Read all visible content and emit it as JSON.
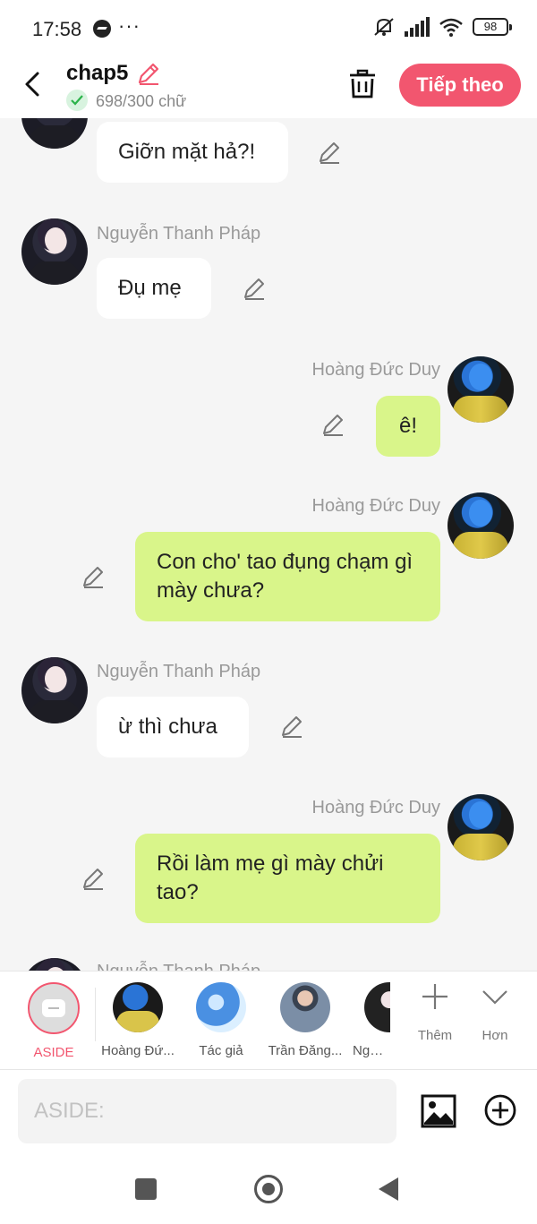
{
  "status_bar": {
    "time": "17:58",
    "dots": "···",
    "battery": "98"
  },
  "header": {
    "title": "chap5",
    "word_count": "698/300 chữ",
    "next_label": "Tiếp theo"
  },
  "messages": [
    {
      "side": "left",
      "sender": "",
      "text": "Giỡn mặt hả?!"
    },
    {
      "side": "left",
      "sender": "Nguyễn Thanh Pháp",
      "text": "Đụ mẹ"
    },
    {
      "side": "right",
      "sender": "Hoàng Đức Duy",
      "text": "ê!"
    },
    {
      "side": "right",
      "sender": "Hoàng Đức Duy",
      "text": "Con cho' tao đụng chạm gì mày chưa?"
    },
    {
      "side": "left",
      "sender": "Nguyễn Thanh Pháp",
      "text": "ừ thì chưa"
    },
    {
      "side": "right",
      "sender": "Hoàng Đức Duy",
      "text": "Rồi làm mẹ gì mày chửi tao?"
    },
    {
      "side": "left",
      "sender": "Nguyễn Thanh Pháp",
      "text": ""
    }
  ],
  "characters": [
    {
      "name": "ASIDE"
    },
    {
      "name": "Hoàng Đứ..."
    },
    {
      "name": "Tác giả"
    },
    {
      "name": "Trần Đăng..."
    },
    {
      "name": "Nguyễ"
    }
  ],
  "tools": {
    "more_label": "Thêm",
    "expand_label": "Hơn"
  },
  "input": {
    "placeholder": "ASIDE:"
  },
  "colors": {
    "accent": "#f2566f",
    "bubble_right": "#d9f58a",
    "bubble_left": "#ffffff",
    "background": "#f5f5f5"
  }
}
